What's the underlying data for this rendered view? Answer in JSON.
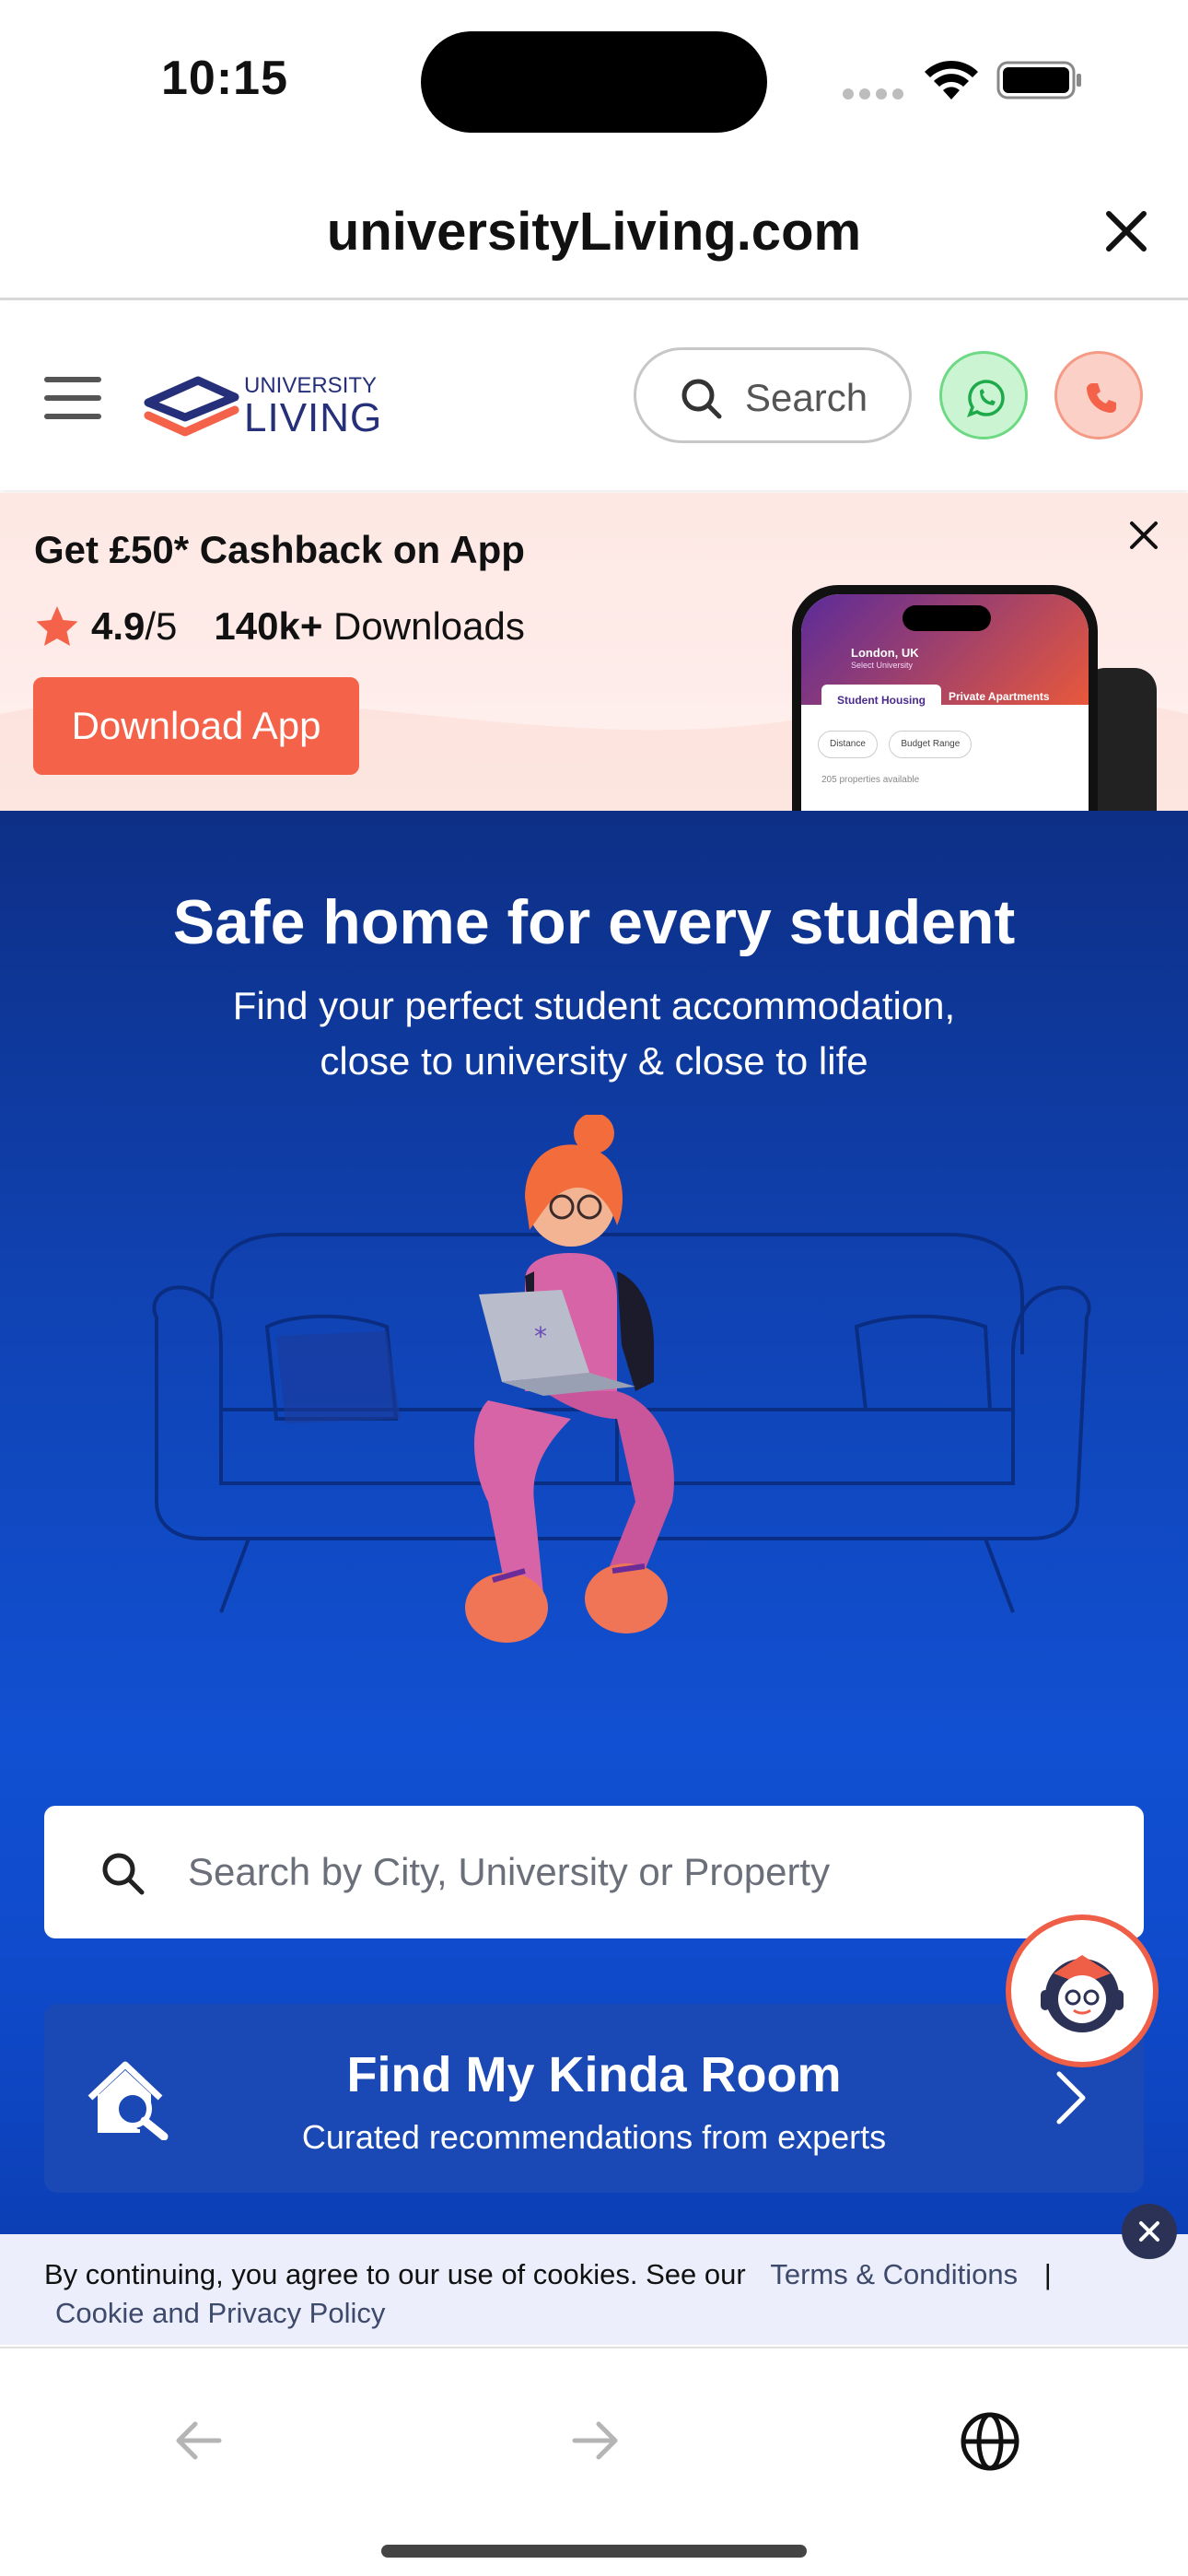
{
  "status_bar": {
    "time": "10:15"
  },
  "browser": {
    "url": "universityLiving.com",
    "back_icon": "arrow-left-icon",
    "forward_icon": "arrow-right-icon",
    "globe_icon": "globe-icon"
  },
  "nav": {
    "logo_top": "UNIVERSITY",
    "logo_bottom": "LIVING",
    "search_label": "Search"
  },
  "promo": {
    "title": "Get £50* Cashback on App",
    "rating": "4.9",
    "rating_suffix": "/5",
    "downloads_bold": "140k+",
    "downloads_text": " Downloads",
    "download_button": "Download App",
    "phone": {
      "location": "London, UK",
      "location_sub": "Select University",
      "tab_1": "Student Housing",
      "tab_2": "Private Apartments",
      "filter_1": "Distance",
      "filter_2": "Budget Range",
      "count": "205 properties available"
    }
  },
  "hero": {
    "title": "Safe home for every student",
    "subtitle_line1": "Find your perfect student accommodation,",
    "subtitle_line2": "close to university & close to life",
    "search_placeholder": "Search by City, University or Property"
  },
  "kinda_room": {
    "title": "Find My Kinda Room",
    "subtitle": "Curated recommendations from experts"
  },
  "cookie": {
    "text": "By continuing, you agree to our use of cookies. See our",
    "terms_link": "Terms & Conditions",
    "separator": "|",
    "policy_link": "Cookie and Privacy Policy"
  },
  "colors": {
    "brand_orange": "#f4624a",
    "brand_navy": "#26307a",
    "hero_blue": "#1043b4",
    "whatsapp_green": "#cbf5d2"
  }
}
